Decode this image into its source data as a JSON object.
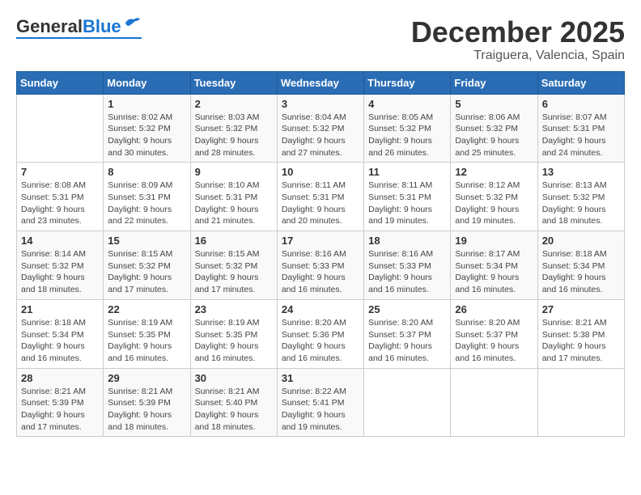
{
  "header": {
    "logo_general": "General",
    "logo_blue": "Blue",
    "month_year": "December 2025",
    "location": "Traiguera, Valencia, Spain"
  },
  "calendar": {
    "days_of_week": [
      "Sunday",
      "Monday",
      "Tuesday",
      "Wednesday",
      "Thursday",
      "Friday",
      "Saturday"
    ],
    "weeks": [
      [
        {
          "day": "",
          "sunrise": "",
          "sunset": "",
          "daylight": ""
        },
        {
          "day": "1",
          "sunrise": "Sunrise: 8:02 AM",
          "sunset": "Sunset: 5:32 PM",
          "daylight": "Daylight: 9 hours and 30 minutes."
        },
        {
          "day": "2",
          "sunrise": "Sunrise: 8:03 AM",
          "sunset": "Sunset: 5:32 PM",
          "daylight": "Daylight: 9 hours and 28 minutes."
        },
        {
          "day": "3",
          "sunrise": "Sunrise: 8:04 AM",
          "sunset": "Sunset: 5:32 PM",
          "daylight": "Daylight: 9 hours and 27 minutes."
        },
        {
          "day": "4",
          "sunrise": "Sunrise: 8:05 AM",
          "sunset": "Sunset: 5:32 PM",
          "daylight": "Daylight: 9 hours and 26 minutes."
        },
        {
          "day": "5",
          "sunrise": "Sunrise: 8:06 AM",
          "sunset": "Sunset: 5:32 PM",
          "daylight": "Daylight: 9 hours and 25 minutes."
        },
        {
          "day": "6",
          "sunrise": "Sunrise: 8:07 AM",
          "sunset": "Sunset: 5:31 PM",
          "daylight": "Daylight: 9 hours and 24 minutes."
        }
      ],
      [
        {
          "day": "7",
          "sunrise": "Sunrise: 8:08 AM",
          "sunset": "Sunset: 5:31 PM",
          "daylight": "Daylight: 9 hours and 23 minutes."
        },
        {
          "day": "8",
          "sunrise": "Sunrise: 8:09 AM",
          "sunset": "Sunset: 5:31 PM",
          "daylight": "Daylight: 9 hours and 22 minutes."
        },
        {
          "day": "9",
          "sunrise": "Sunrise: 8:10 AM",
          "sunset": "Sunset: 5:31 PM",
          "daylight": "Daylight: 9 hours and 21 minutes."
        },
        {
          "day": "10",
          "sunrise": "Sunrise: 8:11 AM",
          "sunset": "Sunset: 5:31 PM",
          "daylight": "Daylight: 9 hours and 20 minutes."
        },
        {
          "day": "11",
          "sunrise": "Sunrise: 8:11 AM",
          "sunset": "Sunset: 5:31 PM",
          "daylight": "Daylight: 9 hours and 19 minutes."
        },
        {
          "day": "12",
          "sunrise": "Sunrise: 8:12 AM",
          "sunset": "Sunset: 5:32 PM",
          "daylight": "Daylight: 9 hours and 19 minutes."
        },
        {
          "day": "13",
          "sunrise": "Sunrise: 8:13 AM",
          "sunset": "Sunset: 5:32 PM",
          "daylight": "Daylight: 9 hours and 18 minutes."
        }
      ],
      [
        {
          "day": "14",
          "sunrise": "Sunrise: 8:14 AM",
          "sunset": "Sunset: 5:32 PM",
          "daylight": "Daylight: 9 hours and 18 minutes."
        },
        {
          "day": "15",
          "sunrise": "Sunrise: 8:15 AM",
          "sunset": "Sunset: 5:32 PM",
          "daylight": "Daylight: 9 hours and 17 minutes."
        },
        {
          "day": "16",
          "sunrise": "Sunrise: 8:15 AM",
          "sunset": "Sunset: 5:32 PM",
          "daylight": "Daylight: 9 hours and 17 minutes."
        },
        {
          "day": "17",
          "sunrise": "Sunrise: 8:16 AM",
          "sunset": "Sunset: 5:33 PM",
          "daylight": "Daylight: 9 hours and 16 minutes."
        },
        {
          "day": "18",
          "sunrise": "Sunrise: 8:16 AM",
          "sunset": "Sunset: 5:33 PM",
          "daylight": "Daylight: 9 hours and 16 minutes."
        },
        {
          "day": "19",
          "sunrise": "Sunrise: 8:17 AM",
          "sunset": "Sunset: 5:34 PM",
          "daylight": "Daylight: 9 hours and 16 minutes."
        },
        {
          "day": "20",
          "sunrise": "Sunrise: 8:18 AM",
          "sunset": "Sunset: 5:34 PM",
          "daylight": "Daylight: 9 hours and 16 minutes."
        }
      ],
      [
        {
          "day": "21",
          "sunrise": "Sunrise: 8:18 AM",
          "sunset": "Sunset: 5:34 PM",
          "daylight": "Daylight: 9 hours and 16 minutes."
        },
        {
          "day": "22",
          "sunrise": "Sunrise: 8:19 AM",
          "sunset": "Sunset: 5:35 PM",
          "daylight": "Daylight: 9 hours and 16 minutes."
        },
        {
          "day": "23",
          "sunrise": "Sunrise: 8:19 AM",
          "sunset": "Sunset: 5:35 PM",
          "daylight": "Daylight: 9 hours and 16 minutes."
        },
        {
          "day": "24",
          "sunrise": "Sunrise: 8:20 AM",
          "sunset": "Sunset: 5:36 PM",
          "daylight": "Daylight: 9 hours and 16 minutes."
        },
        {
          "day": "25",
          "sunrise": "Sunrise: 8:20 AM",
          "sunset": "Sunset: 5:37 PM",
          "daylight": "Daylight: 9 hours and 16 minutes."
        },
        {
          "day": "26",
          "sunrise": "Sunrise: 8:20 AM",
          "sunset": "Sunset: 5:37 PM",
          "daylight": "Daylight: 9 hours and 16 minutes."
        },
        {
          "day": "27",
          "sunrise": "Sunrise: 8:21 AM",
          "sunset": "Sunset: 5:38 PM",
          "daylight": "Daylight: 9 hours and 17 minutes."
        }
      ],
      [
        {
          "day": "28",
          "sunrise": "Sunrise: 8:21 AM",
          "sunset": "Sunset: 5:39 PM",
          "daylight": "Daylight: 9 hours and 17 minutes."
        },
        {
          "day": "29",
          "sunrise": "Sunrise: 8:21 AM",
          "sunset": "Sunset: 5:39 PM",
          "daylight": "Daylight: 9 hours and 18 minutes."
        },
        {
          "day": "30",
          "sunrise": "Sunrise: 8:21 AM",
          "sunset": "Sunset: 5:40 PM",
          "daylight": "Daylight: 9 hours and 18 minutes."
        },
        {
          "day": "31",
          "sunrise": "Sunrise: 8:22 AM",
          "sunset": "Sunset: 5:41 PM",
          "daylight": "Daylight: 9 hours and 19 minutes."
        },
        {
          "day": "",
          "sunrise": "",
          "sunset": "",
          "daylight": ""
        },
        {
          "day": "",
          "sunrise": "",
          "sunset": "",
          "daylight": ""
        },
        {
          "day": "",
          "sunrise": "",
          "sunset": "",
          "daylight": ""
        }
      ]
    ]
  }
}
